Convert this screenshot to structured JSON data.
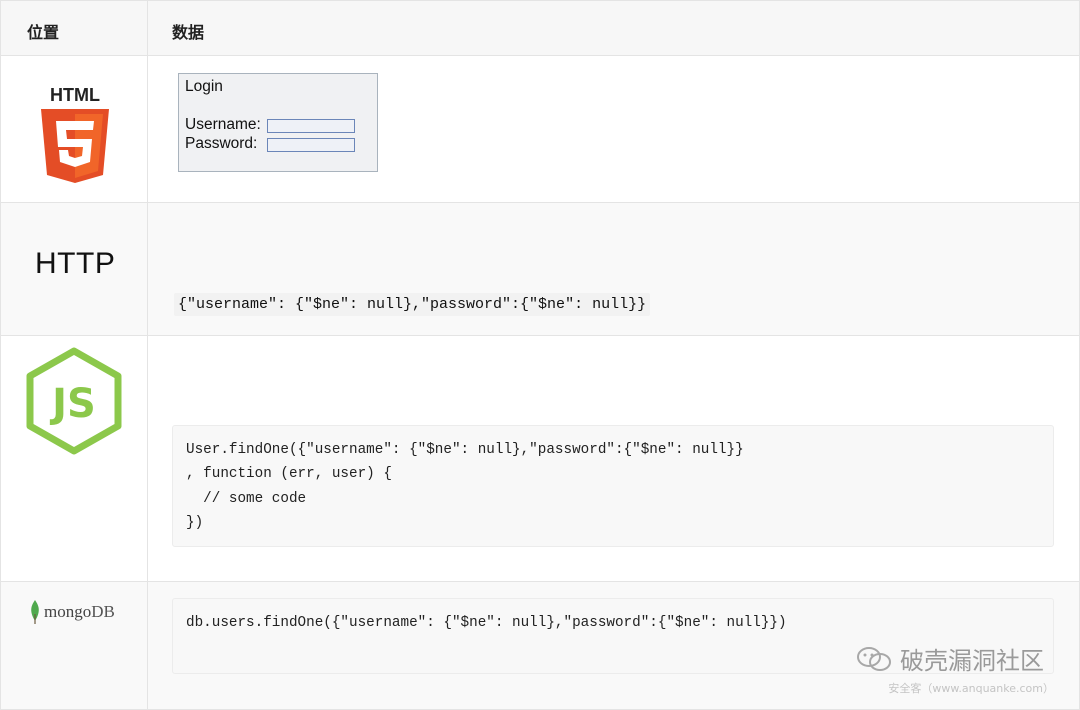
{
  "header": {
    "col_position": "位置",
    "col_data": "数据"
  },
  "rows": {
    "html": {
      "logo_text": "HTML",
      "logo_number": "5",
      "login": {
        "title": "Login",
        "username_label": "Username:",
        "password_label": "Password:"
      }
    },
    "http": {
      "logo_text": "HTTP",
      "payload": "{\"username\": {\"$ne\": null},\"password\":{\"$ne\": null}}"
    },
    "node": {
      "logo_text": "JS",
      "code_lines": [
        "User.findOne({\"username\": {\"$ne\": null},\"password\":{\"$ne\": null}}",
        ", function (err, user) {",
        "  // some code",
        "})"
      ]
    },
    "mongo": {
      "logo_text_1": "mongo",
      "logo_text_2": "DB",
      "code": "db.users.findOne({\"username\": {\"$ne\": null},\"password\":{\"$ne\": null}})"
    }
  },
  "watermark": {
    "text": "破壳漏洞社区",
    "subtext": "安全客（www.anquanke.com）"
  },
  "colors": {
    "html5_orange": "#e44d26",
    "html5_light": "#f16529",
    "node_green": "#8cc84b",
    "mongo_leaf": "#4fa94d"
  }
}
